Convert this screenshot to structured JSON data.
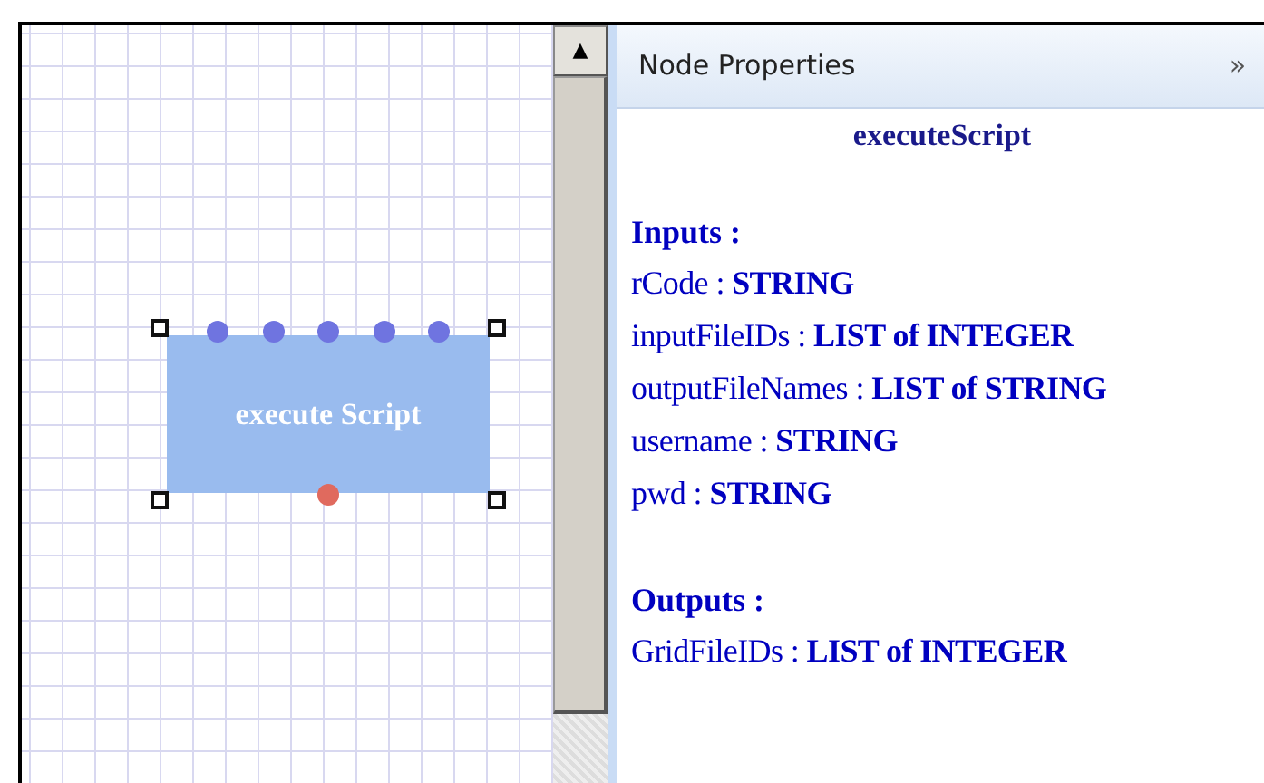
{
  "canvas": {
    "nodes": [
      {
        "label": "execute Script",
        "selected": true,
        "ports": [
          {
            "kind": "input"
          },
          {
            "kind": "input"
          },
          {
            "kind": "input"
          },
          {
            "kind": "input"
          },
          {
            "kind": "input"
          },
          {
            "kind": "output"
          }
        ]
      }
    ]
  },
  "scrollbar": {
    "up_glyph": "▲"
  },
  "panel": {
    "title": "Node Properties",
    "collapse_glyph": "»",
    "node_name": "executeScript",
    "sections": [
      {
        "heading": "Inputs :",
        "items": [
          "rCode : **STRING**",
          "inputFileIDs : **LIST of INTEGER**",
          "outputFileNames : **LIST of STRING**",
          "username : **STRING**",
          "pwd : **STRING**"
        ]
      },
      {
        "heading": "Outputs :",
        "items": [
          "GridFileIDs : **LIST of INTEGER**"
        ]
      }
    ]
  }
}
